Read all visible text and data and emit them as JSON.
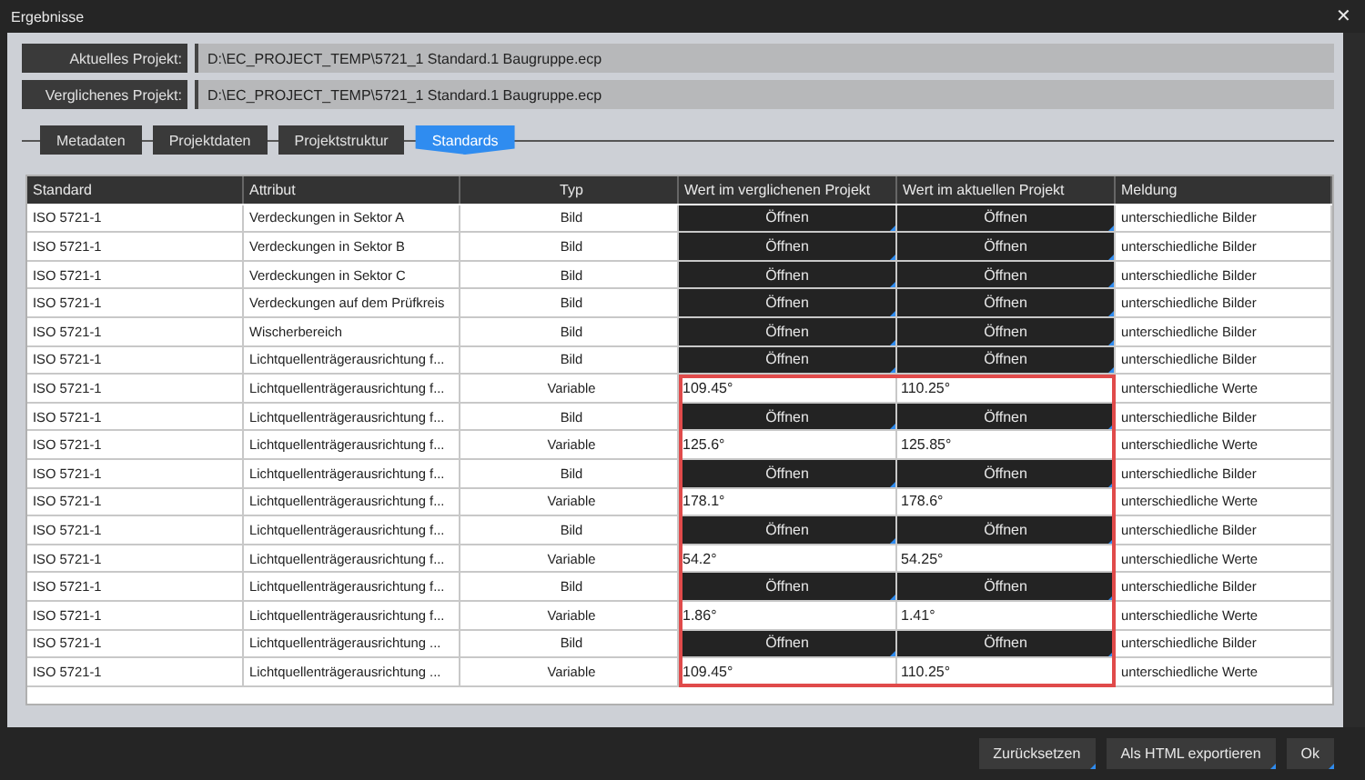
{
  "window": {
    "title": "Ergebnisse",
    "close": "✕"
  },
  "projects": [
    {
      "label": "Aktuelles Projekt:",
      "value": "D:\\EC_PROJECT_TEMP\\5721_1 Standard.1 Baugruppe.ecp"
    },
    {
      "label": "Verglichenes Projekt:",
      "value": "D:\\EC_PROJECT_TEMP\\5721_1 Standard.1 Baugruppe.ecp"
    }
  ],
  "tabs": [
    {
      "label": "Metadaten",
      "selected": false
    },
    {
      "label": "Projektdaten",
      "selected": false
    },
    {
      "label": "Projektstruktur",
      "selected": false
    },
    {
      "label": "Standards",
      "selected": true
    }
  ],
  "table": {
    "columns": [
      "Standard",
      "Attribut",
      "Typ",
      "Wert im verglichenen Projekt",
      "Wert im aktuellen Projekt",
      "Meldung"
    ],
    "rows": [
      {
        "standard": "ISO 5721-1",
        "attribute": "Verdeckungen in Sektor A",
        "type": "Bild",
        "compared": {
          "kind": "button",
          "text": "Öffnen"
        },
        "current": {
          "kind": "button",
          "text": "Öffnen"
        },
        "message": "unterschiedliche Bilder"
      },
      {
        "standard": "ISO 5721-1",
        "attribute": "Verdeckungen in Sektor B",
        "type": "Bild",
        "compared": {
          "kind": "button",
          "text": "Öffnen"
        },
        "current": {
          "kind": "button",
          "text": "Öffnen"
        },
        "message": "unterschiedliche Bilder"
      },
      {
        "standard": "ISO 5721-1",
        "attribute": "Verdeckungen in Sektor C",
        "type": "Bild",
        "compared": {
          "kind": "button",
          "text": "Öffnen"
        },
        "current": {
          "kind": "button",
          "text": "Öffnen"
        },
        "message": "unterschiedliche Bilder"
      },
      {
        "standard": "ISO 5721-1",
        "attribute": "Verdeckungen auf dem Prüfkreis",
        "type": "Bild",
        "compared": {
          "kind": "button",
          "text": "Öffnen"
        },
        "current": {
          "kind": "button",
          "text": "Öffnen"
        },
        "message": "unterschiedliche Bilder"
      },
      {
        "standard": "ISO 5721-1",
        "attribute": "Wischerbereich",
        "type": "Bild",
        "compared": {
          "kind": "button",
          "text": "Öffnen"
        },
        "current": {
          "kind": "button",
          "text": "Öffnen"
        },
        "message": "unterschiedliche Bilder"
      },
      {
        "standard": "ISO 5721-1",
        "attribute": "Lichtquellenträgerausrichtung f...",
        "type": "Bild",
        "compared": {
          "kind": "button",
          "text": "Öffnen"
        },
        "current": {
          "kind": "button",
          "text": "Öffnen"
        },
        "message": "unterschiedliche Bilder"
      }
    ],
    "highlighted_rows": [
      {
        "standard": "ISO 5721-1",
        "attribute": "Lichtquellenträgerausrichtung f...",
        "type": "Variable",
        "compared": {
          "kind": "text",
          "text": "109.45°"
        },
        "current": {
          "kind": "text",
          "text": "110.25°"
        },
        "message": "unterschiedliche Werte"
      },
      {
        "standard": "ISO 5721-1",
        "attribute": "Lichtquellenträgerausrichtung f...",
        "type": "Bild",
        "compared": {
          "kind": "button",
          "text": "Öffnen"
        },
        "current": {
          "kind": "button",
          "text": "Öffnen"
        },
        "message": "unterschiedliche Bilder"
      },
      {
        "standard": "ISO 5721-1",
        "attribute": "Lichtquellenträgerausrichtung f...",
        "type": "Variable",
        "compared": {
          "kind": "text",
          "text": "125.6°"
        },
        "current": {
          "kind": "text",
          "text": "125.85°"
        },
        "message": "unterschiedliche Werte"
      },
      {
        "standard": "ISO 5721-1",
        "attribute": "Lichtquellenträgerausrichtung f...",
        "type": "Bild",
        "compared": {
          "kind": "button",
          "text": "Öffnen"
        },
        "current": {
          "kind": "button",
          "text": "Öffnen"
        },
        "message": "unterschiedliche Bilder"
      },
      {
        "standard": "ISO 5721-1",
        "attribute": "Lichtquellenträgerausrichtung f...",
        "type": "Variable",
        "compared": {
          "kind": "text",
          "text": "178.1°"
        },
        "current": {
          "kind": "text",
          "text": "178.6°"
        },
        "message": "unterschiedliche Werte"
      },
      {
        "standard": "ISO 5721-1",
        "attribute": "Lichtquellenträgerausrichtung f...",
        "type": "Bild",
        "compared": {
          "kind": "button",
          "text": "Öffnen"
        },
        "current": {
          "kind": "button",
          "text": "Öffnen"
        },
        "message": "unterschiedliche Bilder"
      },
      {
        "standard": "ISO 5721-1",
        "attribute": "Lichtquellenträgerausrichtung f...",
        "type": "Variable",
        "compared": {
          "kind": "text",
          "text": "54.2°"
        },
        "current": {
          "kind": "text",
          "text": "54.25°"
        },
        "message": "unterschiedliche Werte"
      },
      {
        "standard": "ISO 5721-1",
        "attribute": "Lichtquellenträgerausrichtung f...",
        "type": "Bild",
        "compared": {
          "kind": "button",
          "text": "Öffnen"
        },
        "current": {
          "kind": "button",
          "text": "Öffnen"
        },
        "message": "unterschiedliche Bilder"
      },
      {
        "standard": "ISO 5721-1",
        "attribute": "Lichtquellenträgerausrichtung f...",
        "type": "Variable",
        "compared": {
          "kind": "text",
          "text": "1.86°"
        },
        "current": {
          "kind": "text",
          "text": "1.41°"
        },
        "message": "unterschiedliche Werte"
      },
      {
        "standard": "ISO 5721-1",
        "attribute": "Lichtquellenträgerausrichtung ...",
        "type": "Bild",
        "compared": {
          "kind": "button",
          "text": "Öffnen"
        },
        "current": {
          "kind": "button",
          "text": "Öffnen"
        },
        "message": "unterschiedliche Bilder"
      },
      {
        "standard": "ISO 5721-1",
        "attribute": "Lichtquellenträgerausrichtung ...",
        "type": "Variable",
        "compared": {
          "kind": "text",
          "text": "109.45°"
        },
        "current": {
          "kind": "text",
          "text": "110.25°"
        },
        "message": "unterschiedliche Werte"
      }
    ]
  },
  "buttons": [
    "Zurücksetzen",
    "Als HTML exportieren",
    "Ok"
  ]
}
